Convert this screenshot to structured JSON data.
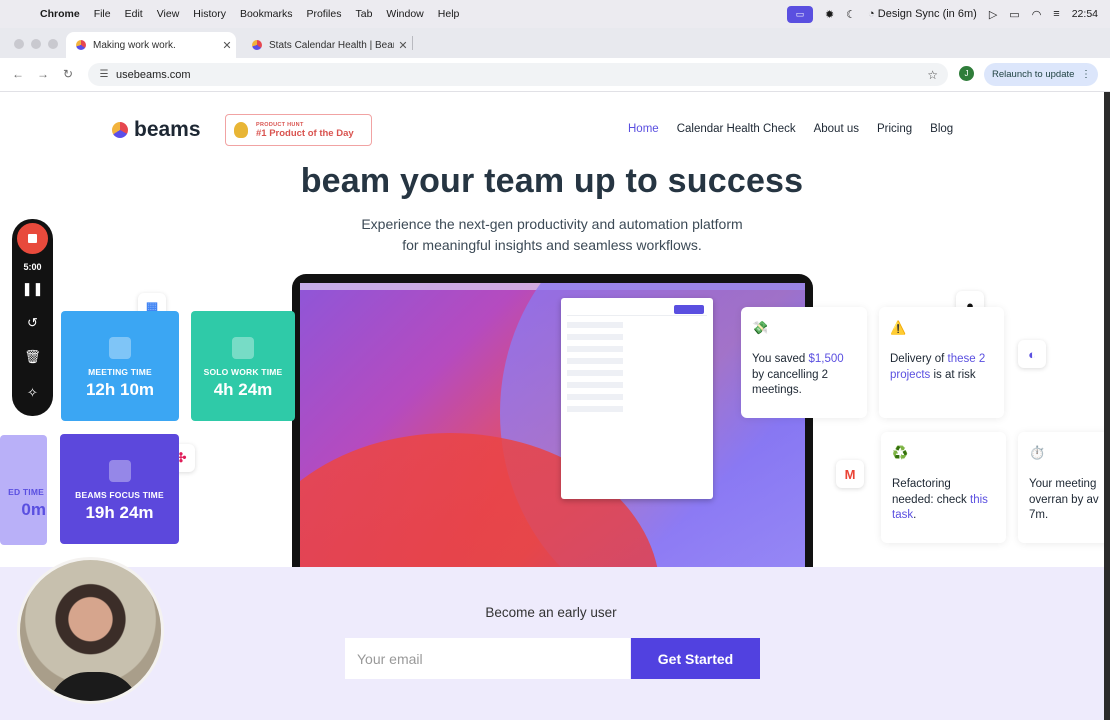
{
  "menubar": {
    "app": "Chrome",
    "items": [
      "File",
      "Edit",
      "View",
      "History",
      "Bookmarks",
      "Profiles",
      "Tab",
      "Window",
      "Help"
    ],
    "status": "Design Sync (in 6m)",
    "time": "22:54"
  },
  "tabs": [
    {
      "title": "Making work work."
    },
    {
      "title": "Stats Calendar Health | Beams"
    }
  ],
  "toolbar": {
    "url": "usebeams.com",
    "profile_initial": "J",
    "relaunch_label": "Relaunch to update"
  },
  "site": {
    "logo": "beams",
    "ph_small": "PRODUCT HUNT",
    "ph_big": "#1 Product of the Day",
    "nav": [
      "Home",
      "Calendar Health Check",
      "About us",
      "Pricing",
      "Blog"
    ],
    "hero_title": "beam your team up to success",
    "hero_sub_line1": "Experience the next-gen productivity and automation platform",
    "hero_sub_line2": "for meaningful insights and seamless workflows."
  },
  "stats": [
    {
      "label": "MEETING TIME",
      "value": "12h 10m"
    },
    {
      "label": "SOLO WORK TIME",
      "value": "4h 24m"
    },
    {
      "label": "BEAMS FOCUS TIME",
      "value": "19h 24m"
    },
    {
      "label": "ED TIME",
      "value": "0m"
    }
  ],
  "info_cards": [
    {
      "emoji": "💸",
      "pre": "You saved ",
      "highlight": "$1,500",
      "post": " by cancelling 2 meetings."
    },
    {
      "emoji": "⚠️",
      "pre": "Delivery of ",
      "highlight": "these 2 projects",
      "post": " is at risk"
    },
    {
      "emoji": "♻️",
      "pre": "Refactoring needed: check ",
      "highlight": "this task",
      "post": "."
    },
    {
      "emoji": "⏱️",
      "pre": "Your meeting overran by av",
      "highlight": "",
      "post": " 7m."
    }
  ],
  "early": {
    "title": "Become an early user",
    "email_placeholder": "Your email",
    "cta": "Get Started"
  },
  "recorder": {
    "time": "5:00"
  },
  "colors": {
    "accent": "#5a4fe0",
    "blue_card": "#3ba6f3",
    "green_card": "#2fcaa8",
    "purple_card": "#5c48dc",
    "early_bg": "#eeebfc"
  }
}
